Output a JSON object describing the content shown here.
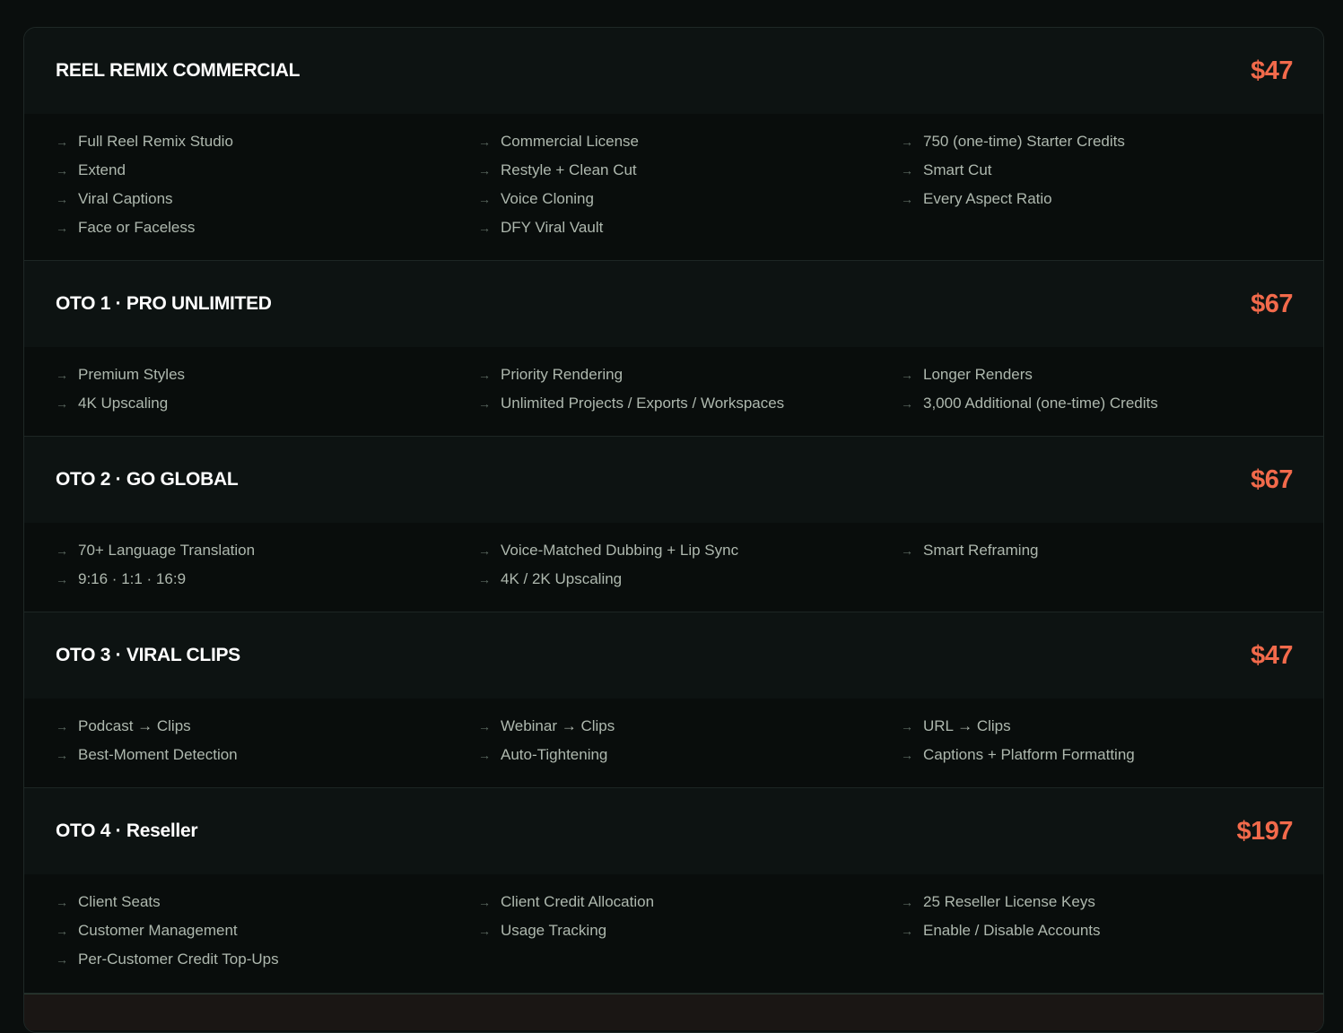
{
  "tiers": [
    {
      "name": "REEL REMIX COMMERCIAL",
      "price": "$47",
      "columns": [
        [
          "Full Reel Remix Studio",
          "Extend",
          "Viral Captions",
          "Face or Faceless"
        ],
        [
          "Commercial License",
          "Restyle + Clean Cut",
          "Voice Cloning",
          "DFY Viral Vault"
        ],
        [
          "750 (one-time) Starter Credits",
          "Smart Cut",
          "Every Aspect Ratio"
        ]
      ]
    },
    {
      "name": "OTO 1 · PRO UNLIMITED",
      "price": "$67",
      "columns": [
        [
          "Premium Styles",
          "4K Upscaling"
        ],
        [
          "Priority Rendering",
          "Unlimited Projects / Exports / Workspaces"
        ],
        [
          "Longer Renders",
          "3,000 Additional (one-time) Credits"
        ]
      ]
    },
    {
      "name": "OTO 2 · GO GLOBAL",
      "price": "$67",
      "columns": [
        [
          "70+ Language Translation",
          "9:16 · 1:1 · 16:9"
        ],
        [
          "Voice-Matched Dubbing + Lip Sync",
          "4K / 2K Upscaling"
        ],
        [
          "Smart Reframing"
        ]
      ]
    },
    {
      "name": "OTO 3 · VIRAL CLIPS",
      "price": "$47",
      "columns": [
        [
          "Podcast → Clips",
          "Best-Moment Detection"
        ],
        [
          "Webinar → Clips",
          "Auto-Tightening"
        ],
        [
          "URL → Clips",
          "Captions + Platform Formatting"
        ]
      ]
    },
    {
      "name": "OTO 4 · Reseller",
      "price": "$197",
      "columns": [
        [
          "Client Seats",
          "Customer Management",
          "Per-Customer Credit Top-Ups"
        ],
        [
          "Client Credit Allocation",
          "Usage Tracking"
        ],
        [
          "25 Reseller License Keys",
          "Enable / Disable Accounts"
        ]
      ]
    }
  ],
  "icons": {
    "bullet": "arrow-right-icon"
  },
  "colors": {
    "price": "#f26a4b",
    "title": "#ffffff",
    "feature": "#aeb8ae"
  }
}
